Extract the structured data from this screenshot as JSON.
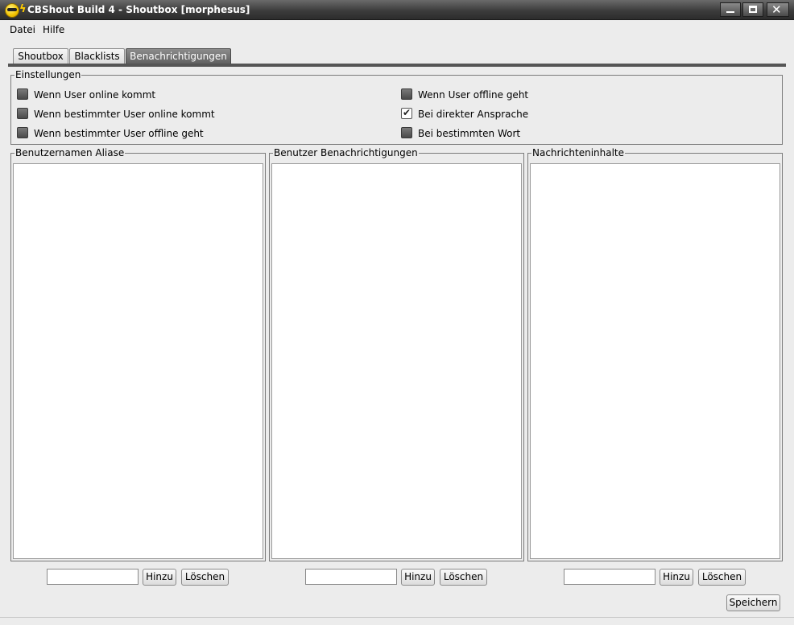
{
  "window": {
    "title": "CBShout Build 4 - Shoutbox [morphesus]"
  },
  "menu": {
    "datei": "Datei",
    "hilfe": "Hilfe"
  },
  "tabs": [
    {
      "label": "Shoutbox",
      "active": false
    },
    {
      "label": "Blacklists",
      "active": false
    },
    {
      "label": "Benachrichtigungen",
      "active": true
    }
  ],
  "settings": {
    "legend": "Einstellungen",
    "options": [
      {
        "label": "Wenn User online kommt",
        "checked": false
      },
      {
        "label": "Wenn bestimmter User online kommt",
        "checked": false
      },
      {
        "label": "Wenn bestimmter User offline geht",
        "checked": false
      },
      {
        "label": "Wenn User offline geht",
        "checked": false
      },
      {
        "label": "Bei direkter Ansprache",
        "checked": true
      },
      {
        "label": "Bei bestimmten Wort",
        "checked": false
      }
    ]
  },
  "panels": [
    {
      "legend": "Benutzernamen Aliase",
      "input_value": "",
      "add_label": "Hinzu",
      "delete_label": "Löschen"
    },
    {
      "legend": "Benutzer Benachrichtigungen",
      "input_value": "",
      "add_label": "Hinzu",
      "delete_label": "Löschen"
    },
    {
      "legend": "Nachrichteninhalte",
      "input_value": "",
      "add_label": "Hinzu",
      "delete_label": "Löschen"
    }
  ],
  "footer": {
    "save_label": "Speichern"
  },
  "icons": {
    "app": "smiley-sunglasses-icon",
    "minimize": "minimize-icon",
    "maximize": "maximize-icon",
    "close": "close-icon"
  },
  "colors": {
    "titlebar": "#3c3c3c",
    "active_tab": "#6e6e6e",
    "background": "#ececec"
  }
}
